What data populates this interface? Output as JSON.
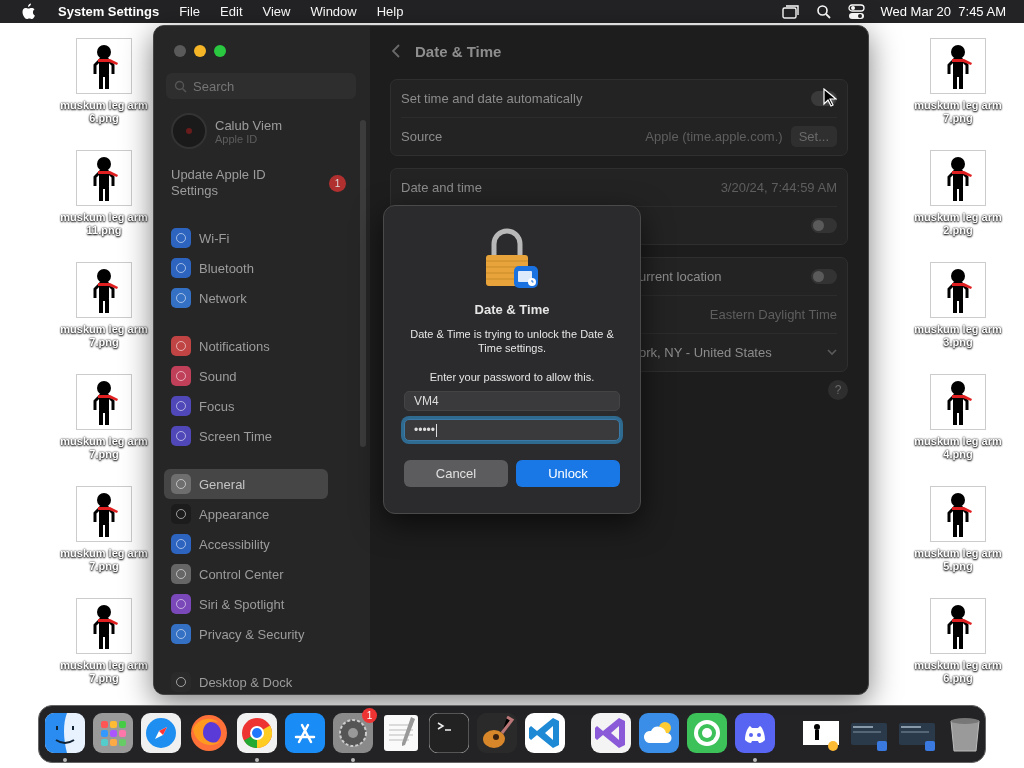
{
  "menubar": {
    "app": "System Settings",
    "menus": [
      "File",
      "Edit",
      "View",
      "Window",
      "Help"
    ],
    "clock": "Wed Mar 20  7:45 AM"
  },
  "desktop_files": {
    "left": [
      "muskum leg arm 6.png",
      "muskum leg arm 11.png",
      "muskum leg arm 7.png",
      "muskum leg arm 7.png",
      "muskum leg arm 7.png",
      "muskum leg arm 7.png"
    ],
    "right": [
      "muskum leg arm 7.png",
      "muskum leg arm 2.png",
      "muskum leg arm 3.png",
      "muskum leg arm 4.png",
      "muskum leg arm 5.png",
      "muskum leg arm 6.png"
    ]
  },
  "window": {
    "sidebar": {
      "search": {
        "placeholder": "Search"
      },
      "account": {
        "name": "Calub Viem",
        "subtitle": "Apple ID"
      },
      "notice": {
        "label": "Update Apple ID Settings",
        "badge": "1"
      },
      "groups": [
        {
          "items": [
            {
              "label": "Wi-Fi",
              "color": "#2c64c0",
              "selected": false
            },
            {
              "label": "Bluetooth",
              "color": "#2c64c0",
              "selected": false
            },
            {
              "label": "Network",
              "color": "#3470c4",
              "selected": false
            }
          ]
        },
        {
          "items": [
            {
              "label": "Notifications",
              "color": "#c04444",
              "selected": false
            },
            {
              "label": "Sound",
              "color": "#c0405a",
              "selected": false
            },
            {
              "label": "Focus",
              "color": "#5048b8",
              "selected": false
            },
            {
              "label": "Screen Time",
              "color": "#5048b8",
              "selected": false
            }
          ]
        },
        {
          "items": [
            {
              "label": "General",
              "color": "#6e6e6e",
              "selected": true
            },
            {
              "label": "Appearance",
              "color": "#1c1c1c",
              "selected": false
            },
            {
              "label": "Accessibility",
              "color": "#2c64c0",
              "selected": false
            },
            {
              "label": "Control Center",
              "color": "#666666",
              "selected": false
            },
            {
              "label": "Siri & Spotlight",
              "color": "#7a48b8",
              "selected": false
            },
            {
              "label": "Privacy & Security",
              "color": "#3470c4",
              "selected": false
            }
          ]
        },
        {
          "items": [
            {
              "label": "Desktop & Dock",
              "color": "#2a2a2a",
              "selected": false
            }
          ]
        }
      ]
    },
    "pane": {
      "title": "Date & Time",
      "groups": [
        {
          "rows": [
            {
              "kind": "toggle",
              "label": "Set time and date automatically",
              "on": true
            },
            {
              "kind": "value",
              "label": "Source",
              "value": "Apple (time.apple.com.)",
              "button": "Set..."
            }
          ]
        },
        {
          "rows": [
            {
              "kind": "value",
              "label": "Date and time",
              "value": "3/20/24, 7:44:59 AM"
            },
            {
              "kind": "toggle",
              "on": false
            }
          ]
        },
        {
          "rows": [
            {
              "kind": "toggle",
              "label": "urrent location",
              "on": false,
              "covered": true
            },
            {
              "kind": "value",
              "value": "Eastern Daylight Time"
            },
            {
              "kind": "popup",
              "label": "ork, NY - United States",
              "covered": true
            }
          ]
        }
      ],
      "help": "?"
    }
  },
  "dialog": {
    "title": "Date & Time",
    "message": "Date & Time is trying to unlock the Date & Time settings.",
    "prompt": "Enter your password to allow this.",
    "fields": [
      {
        "value": "VM4",
        "focused": false
      },
      {
        "value": "•••••",
        "focused": true
      }
    ],
    "buttons": [
      {
        "label": "Cancel",
        "kind": "secondary"
      },
      {
        "label": "Unlock",
        "kind": "primary"
      }
    ]
  },
  "dock": {
    "items": [
      {
        "kind": "finder",
        "running": true
      },
      {
        "kind": "launchpad",
        "running": false
      },
      {
        "kind": "safari",
        "running": false
      },
      {
        "kind": "firefox",
        "running": false
      },
      {
        "kind": "chrome",
        "running": true
      },
      {
        "kind": "appstore",
        "running": false
      },
      {
        "kind": "settings",
        "running": true,
        "badge": "1"
      },
      {
        "kind": "textedit",
        "running": false
      },
      {
        "kind": "terminal",
        "running": false
      },
      {
        "kind": "garageband",
        "running": false
      },
      {
        "kind": "vscode",
        "running": false
      },
      {
        "kind": "separator"
      },
      {
        "kind": "visualstudio",
        "running": false
      },
      {
        "kind": "weather",
        "running": false
      },
      {
        "kind": "findmy",
        "running": false
      },
      {
        "kind": "discord",
        "running": true
      },
      {
        "kind": "separator"
      },
      {
        "kind": "preview",
        "running": false
      },
      {
        "kind": "window",
        "running": false
      },
      {
        "kind": "window",
        "running": false
      },
      {
        "kind": "trash",
        "running": false
      }
    ]
  }
}
